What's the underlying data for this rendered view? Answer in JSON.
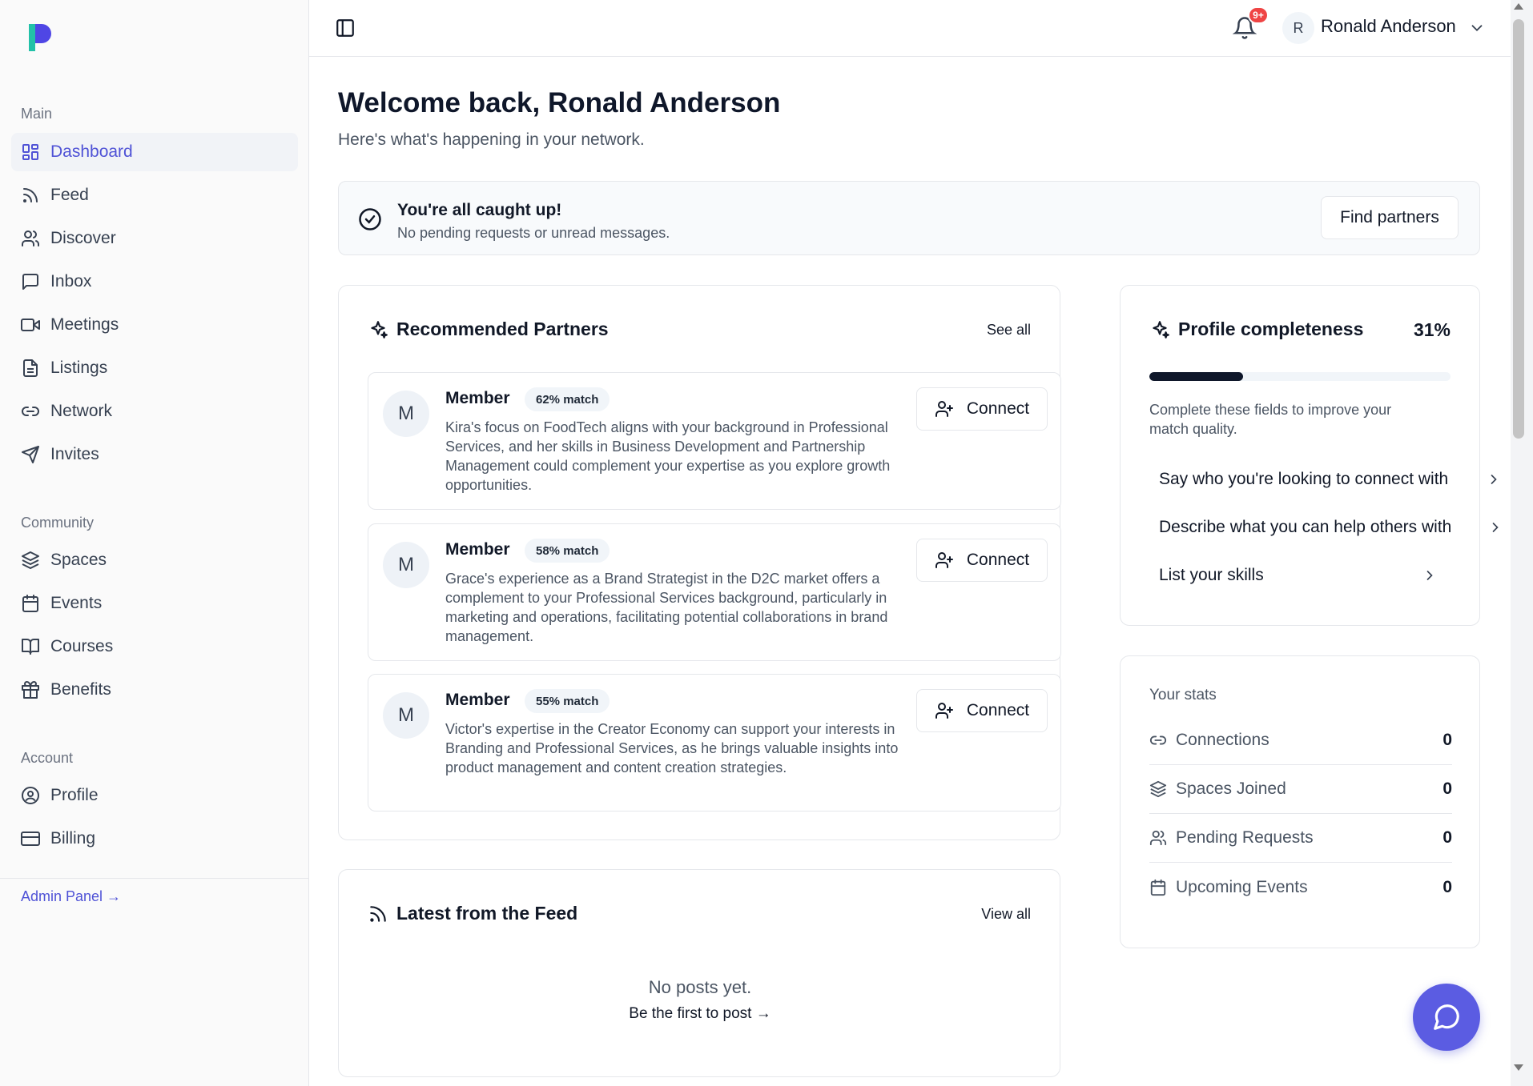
{
  "sidebar": {
    "sections": [
      {
        "title": "Main"
      },
      {
        "title": "Community"
      },
      {
        "title": "Account"
      }
    ],
    "items": [
      {
        "label": "Dashboard",
        "icon": "dashboard-icon",
        "active": true
      },
      {
        "label": "Feed",
        "icon": "rss-icon"
      },
      {
        "label": "Discover",
        "icon": "users-icon"
      },
      {
        "label": "Inbox",
        "icon": "message-square-icon"
      },
      {
        "label": "Meetings",
        "icon": "video-icon"
      },
      {
        "label": "Listings",
        "icon": "file-text-icon"
      },
      {
        "label": "Network",
        "icon": "link-icon"
      },
      {
        "label": "Invites",
        "icon": "send-icon"
      },
      {
        "label": "Spaces",
        "icon": "layers-icon"
      },
      {
        "label": "Events",
        "icon": "calendar-icon"
      },
      {
        "label": "Courses",
        "icon": "book-open-icon"
      },
      {
        "label": "Benefits",
        "icon": "gift-icon"
      },
      {
        "label": "Profile",
        "icon": "user-circle-icon"
      },
      {
        "label": "Billing",
        "icon": "credit-card-icon"
      }
    ],
    "admin_link": "Admin Panel →"
  },
  "header": {
    "notification_badge": "9+",
    "user_initial": "R",
    "user_name": "Ronald Anderson"
  },
  "main": {
    "welcome": "Welcome back, Ronald Anderson",
    "subtitle": "Here's what's happening in your network.",
    "banner": {
      "title": "You're all caught up!",
      "subtitle": "No pending requests or unread messages.",
      "button": "Find partners"
    },
    "recommended": {
      "title": "Recommended Partners",
      "see_all": "See all",
      "partners": [
        {
          "initial": "M",
          "name": "Member",
          "match": "62% match",
          "description": "Kira's focus on FoodTech aligns with your background in Professional Services, and her skills in Business Development and Partnership Management could complement your expertise as you explore growth opportunities.",
          "button": "Connect"
        },
        {
          "initial": "M",
          "name": "Member",
          "match": "58% match",
          "description": "Grace's experience as a Brand Strategist in the D2C market offers a complement to your Professional Services background, particularly in marketing and operations, facilitating potential collaborations in brand management.",
          "button": "Connect"
        },
        {
          "initial": "M",
          "name": "Member",
          "match": "55% match",
          "description": "Victor's expertise in the Creator Economy can support your interests in Branding and Professional Services, as he brings valuable insights into product management and content creation strategies.",
          "button": "Connect"
        }
      ]
    },
    "feed": {
      "title": "Latest from the Feed",
      "view_all": "View all",
      "empty": "No posts yet.",
      "cta": "Be the first to post →"
    },
    "profile": {
      "title": "Profile completeness",
      "percent_label": "31%",
      "percent_value": 0.31,
      "note": "Complete these fields to improve your match quality.",
      "todos": [
        {
          "label": "Say who you're looking to connect with"
        },
        {
          "label": "Describe what you can help others with"
        },
        {
          "label": "List your skills"
        }
      ]
    },
    "stats": {
      "title": "Your stats",
      "rows": [
        {
          "label": "Connections",
          "value": "0",
          "icon": "link-icon"
        },
        {
          "label": "Spaces Joined",
          "value": "0",
          "icon": "layers-icon"
        },
        {
          "label": "Pending Requests",
          "value": "0",
          "icon": "users-icon"
        },
        {
          "label": "Upcoming Events",
          "value": "0",
          "icon": "calendar-icon"
        }
      ]
    }
  },
  "colors": {
    "accent": "#4f52d6",
    "fab": "#5b5ce2",
    "badge": "#ef4444",
    "progress": "#0f172a"
  }
}
